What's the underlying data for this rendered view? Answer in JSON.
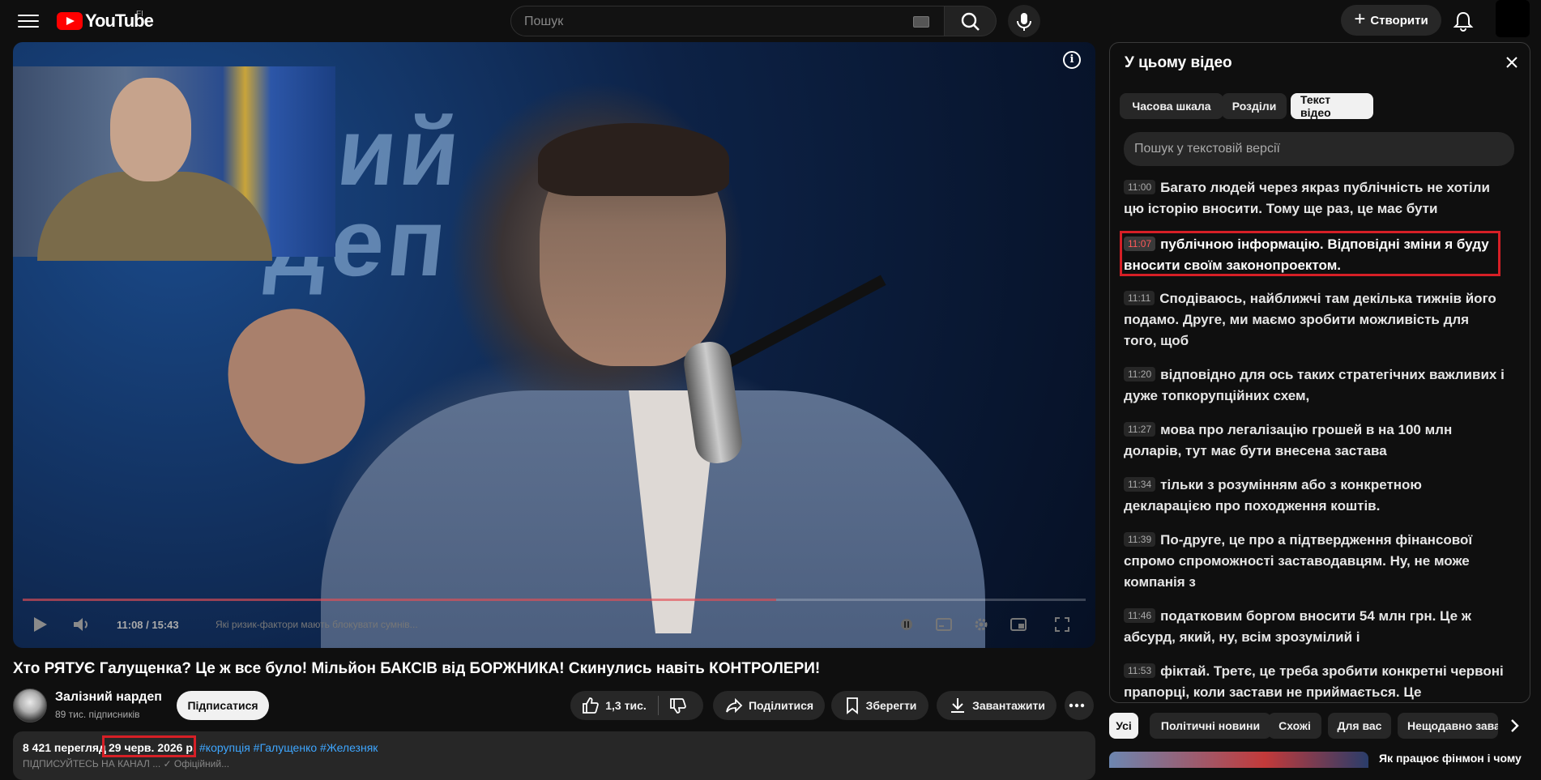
{
  "header": {
    "logo_text": "YouTube",
    "country_code": "FI",
    "search_placeholder": "Пошук",
    "create_label": "Створити"
  },
  "player": {
    "time": "11:08 / 15:43",
    "progress": 0.709,
    "chapter": "Які ризик-фактори мають блокувати сумнів...",
    "overlay_text": "ний\nдеп"
  },
  "video": {
    "title": "Хто РЯТУЄ Галущенка? Це ж все було! Мільйон БАКСІВ від БОРЖНИКА! Скинулись навіть КОНТРОЛЕРИ!",
    "channel_name": "Залізний нардеп",
    "subscribers": "89 тис. підписників",
    "subscribe_label": "Підписатися",
    "likes": "1,3 тис.",
    "share_label": "Поділитися",
    "save_label": "Зберегти",
    "download_label": "Завантажити",
    "views": "8 421 перегляд",
    "date": "29 черв. 2026 р.",
    "hashtags": "#корупція #Галущенко #Железняк",
    "description_preview": "ПІДПИСУЙТЕСЬ НА КАНАЛ ... ✓ Офіційний..."
  },
  "panel": {
    "title": "У цьому відео",
    "tabs": [
      "Часова шкала",
      "Розділи",
      "Текст відео"
    ],
    "active_tab": 2,
    "search_placeholder": "Пошук у текстовій версії",
    "segments": [
      {
        "time": "11:00",
        "text": "Багато людей через якраз публічність не хотіли цю історію вносити. Тому ще раз, це має бути"
      },
      {
        "time": "11:07",
        "text": "публічною інформацію. Відповідні зміни я буду вносити своїм законопроектом."
      },
      {
        "time": "11:11",
        "text": "Сподіваюсь, найближчі там декілька тижнів його подамо. Друге, ми маємо зробити можливість для того, щоб"
      },
      {
        "time": "11:20",
        "text": "відповідно для ось таких стратегічних важливих і дуже топкорупційних схем,"
      },
      {
        "time": "11:27",
        "text": "мова про легалізацію грошей в на 100 млн доларів, тут має бути внесена застава"
      },
      {
        "time": "11:34",
        "text": "тільки з розумінням або з конкретною декларацією про походження коштів."
      },
      {
        "time": "11:39",
        "text": "По-друге, це про а підтвердження фінансової спромо спроможності заставодавцям. Ну, не може компанія з"
      },
      {
        "time": "11:46",
        "text": "податковим боргом вносити 54 млн грн. Це ж абсурд, який, ну, всім зрозумілий і"
      },
      {
        "time": "11:53",
        "text": "фіктай. Третє, це треба зробити конкретні червоні прапорці, коли застави не приймається. Це"
      }
    ]
  },
  "filters": {
    "chips": [
      "Усі",
      "Політичні новини",
      "Схожі",
      "Для вас",
      "Нещодавно заван"
    ],
    "recommendation_title": "Як працює фінмон і чому"
  },
  "colors": {
    "accent_red": "#d61f26",
    "link_blue": "#3ea6ff",
    "background": "#0f0f0f"
  }
}
